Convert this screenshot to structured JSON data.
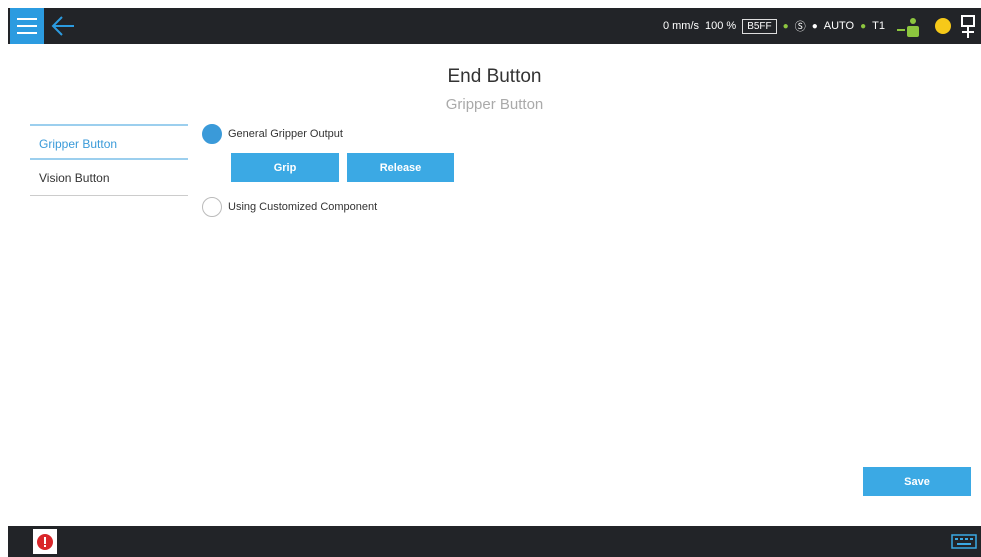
{
  "header": {
    "speed": "0 mm/s",
    "override": "100 %",
    "code": "B5FF",
    "mode": "AUTO",
    "tool": "T1"
  },
  "page": {
    "title": "End Button",
    "subtitle": "Gripper Button"
  },
  "sidebar": {
    "items": [
      {
        "label": "Gripper Button",
        "active": true
      },
      {
        "label": "Vision Button",
        "active": false
      }
    ]
  },
  "options": {
    "general": {
      "label": "General Gripper Output",
      "checked": true
    },
    "custom": {
      "label": "Using Customized Component",
      "checked": false
    }
  },
  "buttons": {
    "grip": "Grip",
    "release": "Release",
    "save": "Save"
  },
  "colors": {
    "accent": "#3ba9e4",
    "topbar": "#222428",
    "status_green": "#8dc63f",
    "status_yellow": "#f6c919",
    "alert_red": "#d9262a"
  },
  "icons": [
    "menu-icon",
    "back-arrow-icon",
    "robot-icon",
    "status-dot-icon",
    "pendant-icon",
    "alert-icon",
    "keyboard-icon"
  ]
}
